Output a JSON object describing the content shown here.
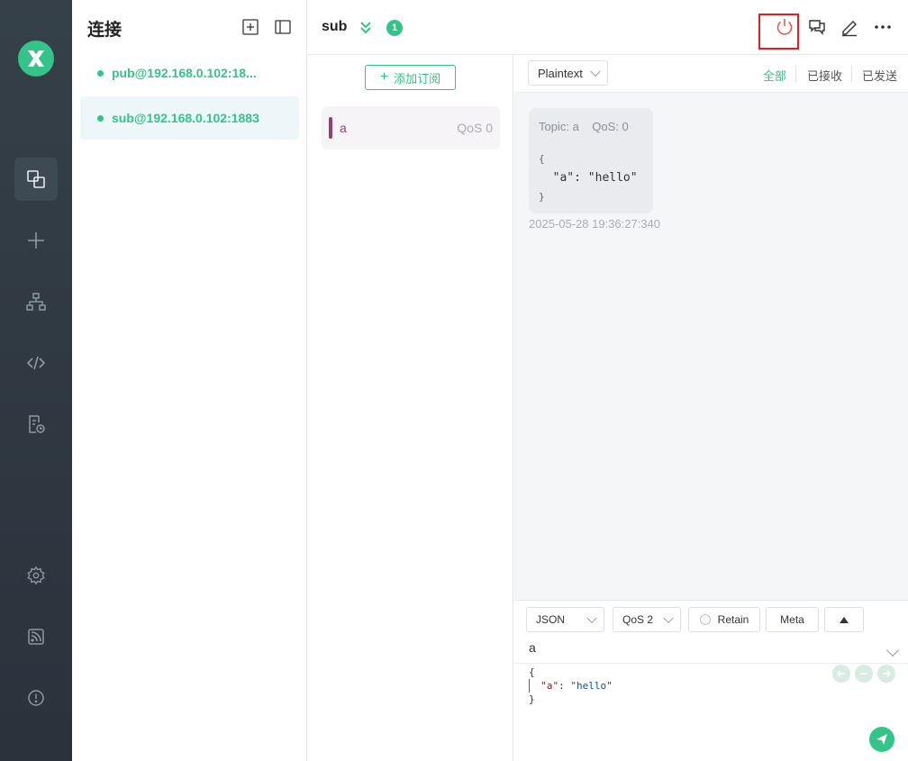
{
  "rail": {
    "items": [
      {
        "name": "connections-icon"
      },
      {
        "name": "new-connection-icon"
      },
      {
        "name": "topology-icon"
      },
      {
        "name": "script-icon"
      },
      {
        "name": "log-icon"
      },
      {
        "name": "settings-icon"
      },
      {
        "name": "feed-icon"
      },
      {
        "name": "about-icon"
      }
    ]
  },
  "connections": {
    "title": "连接",
    "items": [
      {
        "label": "pub@192.168.0.102:18...",
        "status": "connected"
      },
      {
        "label": "sub@192.168.0.102:1883",
        "status": "connected",
        "active": true
      }
    ]
  },
  "header": {
    "title": "sub",
    "badge": "1"
  },
  "subscriptions": {
    "add_label": "添加订阅",
    "items": [
      {
        "topic": "a",
        "qos": "QoS 0",
        "color": "#92416f"
      }
    ]
  },
  "messages": {
    "format": "Plaintext",
    "filters": {
      "all": "全部",
      "received": "已接收",
      "sent": "已发送"
    },
    "items": [
      {
        "topic_label": "Topic: a",
        "qos_label": "QoS: 0",
        "open_brace": "{",
        "body": "  \"a\": \"hello\"",
        "close_brace": "}",
        "time": "2025-05-28 19:36:27:340"
      }
    ]
  },
  "publish": {
    "format": "JSON",
    "qos": "QoS 2",
    "retain_label": "Retain",
    "meta_label": "Meta",
    "topic": "a",
    "payload": {
      "open_brace": "{",
      "key": "\"a\"",
      "colon": ": ",
      "value": "\"hello\"",
      "close_brace": "}"
    }
  },
  "colors": {
    "accent": "#34c388",
    "highlight": "#e02020",
    "subscription": "#92416f"
  }
}
